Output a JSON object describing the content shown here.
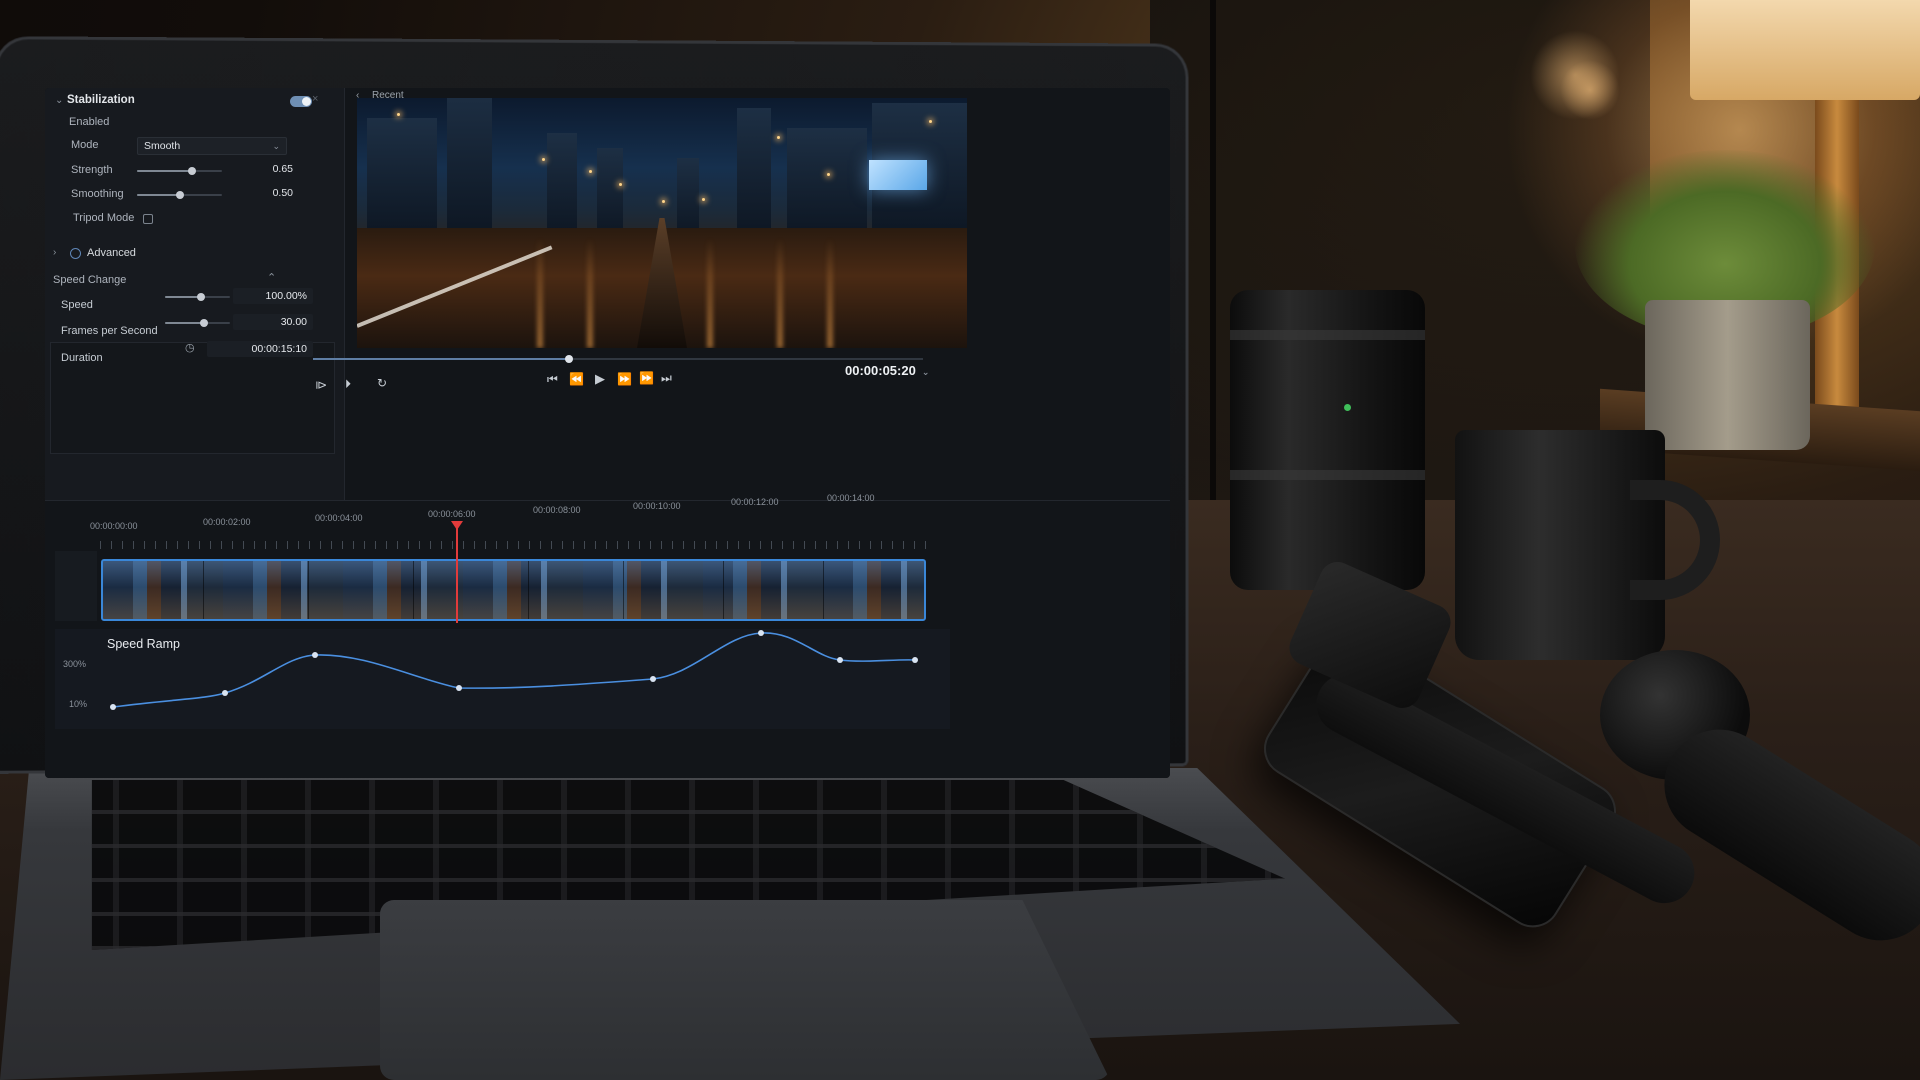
{
  "stabilization": {
    "title": "Stabilization",
    "enabled_label": "Enabled",
    "enabled_on": true,
    "mode_label": "Mode",
    "mode_value": "Smooth",
    "strength_label": "Strength",
    "strength_value": "0.65",
    "strength_level": 0.65,
    "smoothing_label": "Smoothing",
    "smoothing_value": "0.50",
    "smoothing_level": 0.5,
    "tripod_label": "Tripod Mode",
    "tripod_checked": false,
    "advanced_label": "Advanced"
  },
  "speed_change": {
    "title": "Speed Change",
    "speed_label": "Speed",
    "speed_value": "100.00%",
    "speed_level": 0.55,
    "fps_label": "Frames per Second",
    "fps_value": "30.00",
    "fps_level": 0.6,
    "duration_label": "Duration",
    "duration_value": "00:00:15:10"
  },
  "preview": {
    "tab_label": "Recent",
    "timecode": "00:00:05:20",
    "scrub_level": 0.42
  },
  "timeline": {
    "ruler": [
      "00:00:00:00",
      "00:00:02:00",
      "00:00:04:00",
      "00:00:06:00",
      "00:00:08:00",
      "00:00:10:00",
      "00:00:12:00",
      "00:00:14:00"
    ],
    "playhead_time": "00:00:06:00"
  },
  "speed_ramp": {
    "title": "Speed Ramp",
    "y_top": "300%",
    "y_bottom": "10%"
  },
  "colors": {
    "accent": "#3a87d8",
    "playhead": "#e23b3b",
    "curve": "#4a8fe0"
  },
  "icons": {
    "to_start": "⏮",
    "step_back": "⏪",
    "play": "▶",
    "step_forward": "⏩",
    "to_end": "⏭",
    "loop": "↻"
  }
}
